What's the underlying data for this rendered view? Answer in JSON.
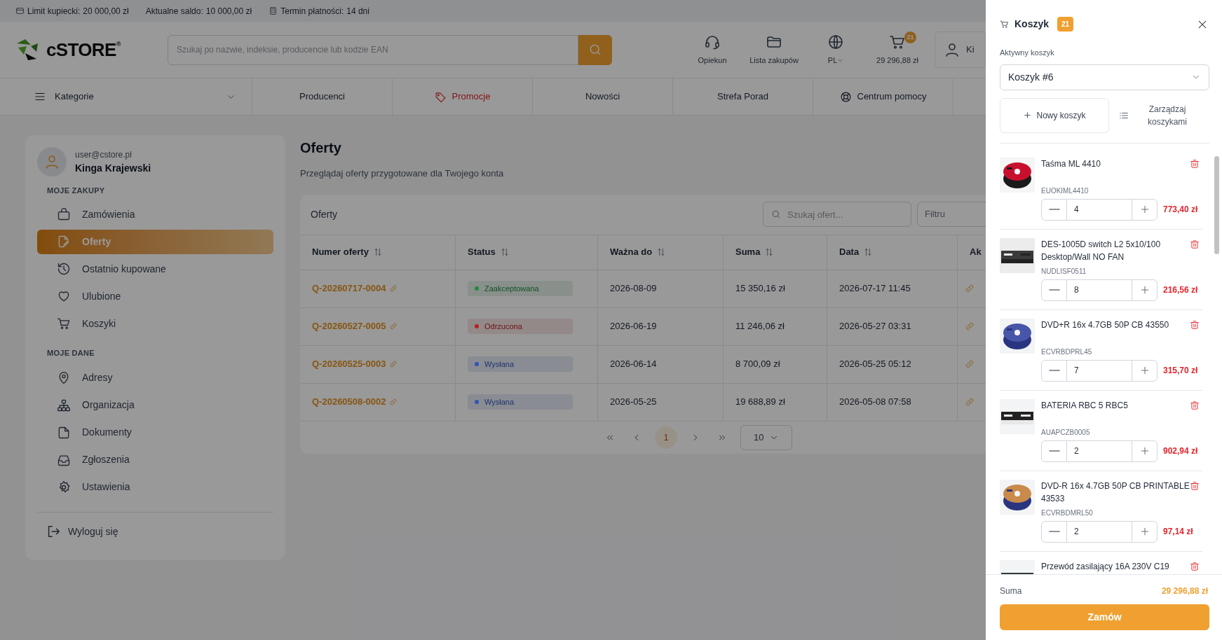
{
  "top_bar": [
    {
      "kind": "card",
      "label": "Limit kupiecki:",
      "value": "20 000,00 zł"
    },
    {
      "kind": "plain",
      "label": "Aktualne saldo:",
      "value": "10 000,00 zł"
    },
    {
      "kind": "calculator",
      "label": "Termin płatności:",
      "value": "14 dni"
    }
  ],
  "logo": {
    "text": "cSTORE",
    "mark": "®"
  },
  "search": {
    "placeholder": "Szukaj po nazwie, indeksie, producencie lub kodzie EAN"
  },
  "header_actions": [
    {
      "kind": "headset",
      "label": "Opiekun"
    },
    {
      "kind": "folder",
      "label": "Lista zakupów"
    },
    {
      "kind": "language",
      "label": "PL"
    },
    {
      "kind": "cart",
      "label": "29 296,88 zł",
      "badge": "21"
    }
  ],
  "user_button": {
    "label": "Ki"
  },
  "nav": [
    {
      "kind": "categories",
      "label": "Kategorie"
    },
    {
      "kind": "plain",
      "label": "Producenci"
    },
    {
      "kind": "promo",
      "label": "Promocje"
    },
    {
      "kind": "plain",
      "label": "Nowości"
    },
    {
      "kind": "plain",
      "label": "Strefa Porad"
    },
    {
      "kind": "help",
      "label": "Centrum pomocy"
    }
  ],
  "sidebar": {
    "email": "user@cstore.pl",
    "name": "Kinga Krajewski",
    "sections": [
      {
        "title": "MOJE ZAKUPY",
        "items": [
          {
            "kind": "bag",
            "label": "Zamówienia",
            "selected": false
          },
          {
            "kind": "offer",
            "label": "Oferty",
            "selected": true
          },
          {
            "kind": "history",
            "label": "Ostatnio kupowane",
            "selected": false
          },
          {
            "kind": "heart",
            "label": "Ulubione",
            "selected": false
          },
          {
            "kind": "cart",
            "label": "Koszyki",
            "selected": false
          }
        ]
      },
      {
        "title": "MOJE DANE",
        "items": [
          {
            "kind": "pin",
            "label": "Adresy",
            "selected": false
          },
          {
            "kind": "org",
            "label": "Organizacja",
            "selected": false
          },
          {
            "kind": "file",
            "label": "Dokumenty",
            "selected": false
          },
          {
            "kind": "inbox",
            "label": "Zgłoszenia",
            "selected": false
          },
          {
            "kind": "gear",
            "label": "Ustawienia",
            "selected": false
          }
        ]
      }
    ],
    "logout": "Wyloguj się"
  },
  "page": {
    "title": "Oferty",
    "subtitle": "Przeglądaj oferty przygotowane dla Twojego konta"
  },
  "offers": {
    "title": "Oferty",
    "search_placeholder": "Szukaj ofert...",
    "filter_button": "Filtru",
    "columns": [
      "Numer oferty",
      "Status",
      "Ważna do",
      "Suma",
      "Data",
      "Ak"
    ],
    "rows": [
      {
        "number": "Q-20260717-0004",
        "status": "Zaakceptowana",
        "color": "#1e8a40",
        "valid_until": "2026-08-09",
        "total": "15 350,16 zł",
        "date": "2026-07-17 11:45"
      },
      {
        "number": "Q-20260527-0005",
        "status": "Odrzucona",
        "color": "#b52222",
        "valid_until": "2026-06-19",
        "total": "11 246,06 zł",
        "date": "2026-05-27 03:31"
      },
      {
        "number": "Q-20260525-0003",
        "status": "Wysłana",
        "color": "#2f55b5",
        "valid_until": "2026-06-14",
        "total": "8 700,09 zł",
        "date": "2026-05-25 05:12"
      },
      {
        "number": "Q-20260508-0002",
        "status": "Wysłana",
        "color": "#2f55b5",
        "valid_until": "2026-05-25",
        "total": "19 688,89 zł",
        "date": "2026-05-08 07:58"
      }
    ],
    "pagination": {
      "pages": [
        {
          "label": "1",
          "selected": true
        }
      ],
      "page_size": "10"
    }
  },
  "cart": {
    "title": "Koszyk",
    "count": "21",
    "active_label": "Aktywny koszyk",
    "selected_cart": "Koszyk #6",
    "new_button": "Nowy koszyk",
    "manage_button": "Zarządzaj koszykami",
    "items": [
      {
        "name": "Taśma ML 4410",
        "code": "EUOKIML4410",
        "quantity": "4",
        "price": "773,40 zł"
      },
      {
        "name": "DES-1005D switch L2 5x10/100 Desktop/Wall NO FAN",
        "code": "NUDLISF0511",
        "quantity": "8",
        "price": "216,56 zł"
      },
      {
        "name": "DVD+R 16x 4.7GB 50P CB 43550",
        "code": "ECVRBDPRL45",
        "quantity": "7",
        "price": "315,70 zł"
      },
      {
        "name": "BATERIA RBC 5 RBC5",
        "code": "AUAPCZB0005",
        "quantity": "2",
        "price": "902,94 zł"
      },
      {
        "name": "DVD-R 16x 4.7GB 50P CB PRINTABLE 43533",
        "code": "ECVRBDMRL50",
        "quantity": "2",
        "price": "97,14 zł"
      },
      {
        "name": "Przewód zasilający 16A 230V C19"
      }
    ],
    "total_label": "Suma",
    "total": "29 296,88 zł",
    "order_button": "Zamów"
  }
}
